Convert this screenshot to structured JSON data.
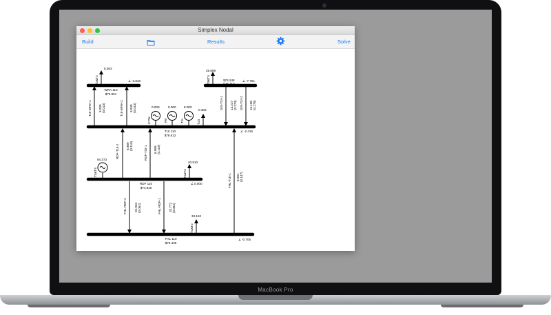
{
  "device": {
    "label": "MacBook Pro"
  },
  "window": {
    "title": "Simplex Nodal",
    "traffic_light_colors": [
      "#fe5f57",
      "#febc2e",
      "#28c840"
    ]
  },
  "toolbar": {
    "build_label": "Build",
    "results_label": "Results",
    "solve_label": "Solve",
    "accent_color": "#1a7bf0",
    "folder_icon": "folder-icon",
    "settings_icon": "gear-icon"
  },
  "diagram": {
    "buses": {
      "wra": {
        "name": "WRA 110",
        "voltage": "$76.951",
        "angle": "-2.840"
      },
      "gis": {
        "name": "GIS 110",
        "voltage": "$78.248",
        "angle": "-7.751"
      },
      "tui": {
        "name": "TUI 110",
        "voltage": "$76.612",
        "angle": "-2.416"
      },
      "rdf": {
        "name": "RDF 110",
        "voltage": "$74.910",
        "angle": "0.000"
      },
      "fhl": {
        "name": "FHL 110",
        "voltage": "$75.435",
        "angle": "-0.705"
      }
    },
    "loads": {
      "wra_t1t2": {
        "name": "T1&T2",
        "value": "6.053"
      },
      "gis_t3t4": {
        "name": "T3&T4",
        "value": "25.869"
      },
      "tui_t1s": {
        "name": "T1S",
        "value": "0.303"
      },
      "rdf_t1t2": {
        "name": "T1&T2",
        "value": "40.910"
      },
      "fhl_t1t2": {
        "name": "T1&T2",
        "value": "33.152"
      }
    },
    "generators": {
      "kyw": {
        "name": "KYW",
        "value": "0.000"
      },
      "pb": {
        "name": "PB",
        "value": "5.000"
      },
      "t1l": {
        "name": "T1L",
        "value": "8.000"
      },
      "rdf_t3t4": {
        "name": "T3&T4",
        "value": "94.373"
      }
    },
    "lines": {
      "tui_wra_1": {
        "name": "TUI-WRA-1",
        "flow": "3.039",
        "loss": "(0.013)"
      },
      "tui_wra_2": {
        "name": "TUI-WRA-2",
        "flow": "3.040",
        "loss": "(0.013)"
      },
      "gis_tui_1": {
        "name": "GIS-TUI-1",
        "flow": "13.227",
        "loss": "(0.274)"
      },
      "gis_tui_2": {
        "name": "GIS-TUI-2",
        "flow": "15.185",
        "loss": "(0.278)"
      },
      "rdf_tui_2": {
        "name": "RDF-TUI-2",
        "flow": "6.989",
        "loss": "(0.119)"
      },
      "rdf_tui_1": {
        "name": "RDF-TUI-1",
        "flow": "6.989",
        "loss": "(0.119)"
      },
      "fhl_tui_1": {
        "name": "FHL-TUI-1",
        "flow": "8.001",
        "loss": "(0.147)"
      },
      "fhl_rdf_2": {
        "name": "FHL-RDF-2",
        "flow": "20.934",
        "loss": "(0.062)"
      },
      "fhl_rdf_1": {
        "name": "FHL-RDF-1",
        "flow": "20.772",
        "loss": "(0.062)"
      }
    }
  }
}
